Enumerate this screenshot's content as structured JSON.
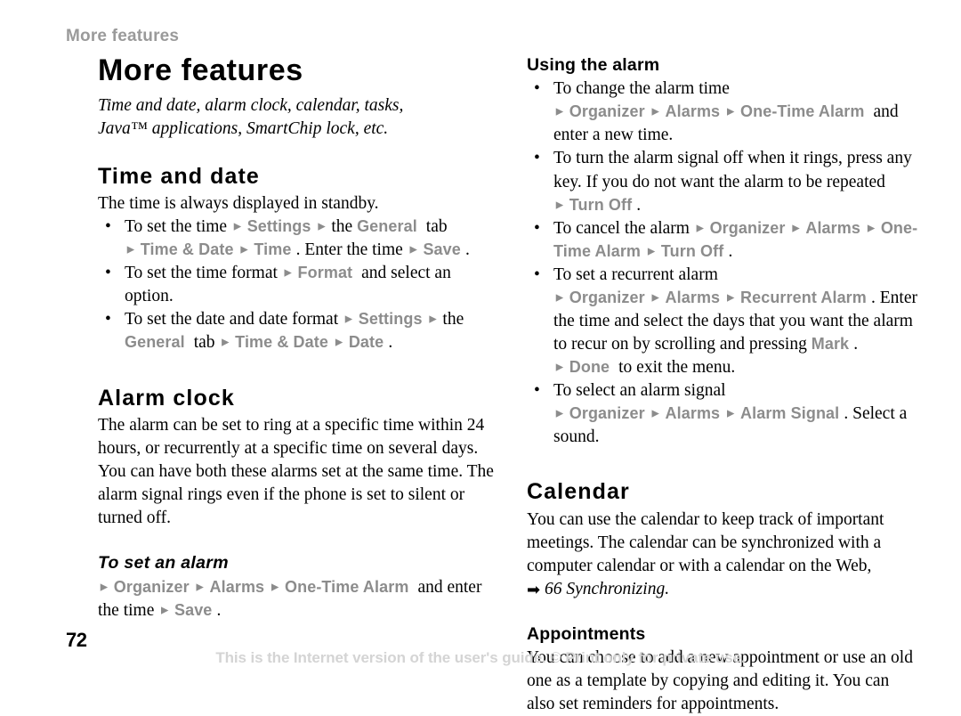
{
  "running_header": "More features",
  "title": "More features",
  "subtitle_line1": "Time and date, alarm clock, calendar, tasks,",
  "subtitle_line2": "Java™ applications, SmartChip lock, etc.",
  "icons": {
    "menu_arrow": "►",
    "xref_arrow": "➡",
    "bullet": "•"
  },
  "colors": {
    "ui_term_gray": "#8c8c8c",
    "running_header_gray": "#9a9a9a",
    "footer_gray": "#d4d4d4",
    "text_black": "#000000",
    "page_background": "#ffffff"
  },
  "left_column": {
    "section_time_and_date": {
      "heading": "Time and date",
      "intro": "The time is always displayed in standby.",
      "bullets": [
        {
          "id": "set-the-time",
          "parts": [
            {
              "t": "text",
              "v": "To set the time "
            },
            {
              "t": "arrow"
            },
            {
              "t": "ui",
              "v": "Settings"
            },
            {
              "t": "arrow"
            },
            {
              "t": "text",
              "v": "the "
            },
            {
              "t": "ui",
              "v": "General"
            },
            {
              "t": "text",
              "v": " tab "
            },
            {
              "t": "arrow"
            },
            {
              "t": "ui",
              "v": "Time & Date"
            },
            {
              "t": "arrow"
            },
            {
              "t": "ui",
              "v": "Time"
            },
            {
              "t": "text",
              "v": ". Enter the time "
            },
            {
              "t": "arrow"
            },
            {
              "t": "ui",
              "v": "Save"
            },
            {
              "t": "text",
              "v": "."
            }
          ]
        },
        {
          "id": "set-the-time-format",
          "parts": [
            {
              "t": "text",
              "v": "To set the time format "
            },
            {
              "t": "arrow"
            },
            {
              "t": "ui",
              "v": "Format"
            },
            {
              "t": "text",
              "v": " and select an option."
            }
          ]
        },
        {
          "id": "set-the-date-and-date-format",
          "parts": [
            {
              "t": "text",
              "v": "To set the date and date format "
            },
            {
              "t": "arrow"
            },
            {
              "t": "ui",
              "v": "Settings"
            },
            {
              "t": "arrow"
            },
            {
              "t": "text",
              "v": "the "
            },
            {
              "t": "ui",
              "v": "General"
            },
            {
              "t": "text",
              "v": " tab "
            },
            {
              "t": "arrow"
            },
            {
              "t": "ui",
              "v": "Time & Date"
            },
            {
              "t": "arrow"
            },
            {
              "t": "ui",
              "v": "Date"
            },
            {
              "t": "text",
              "v": "."
            }
          ]
        }
      ]
    },
    "section_alarm_clock": {
      "heading": "Alarm clock",
      "body": "The alarm can be set to ring at a specific time within 24 hours, or recurrently at a specific time on several days. You can have both these alarms set at the same time. The alarm signal rings even if the phone is set to silent or turned off.",
      "sub_to_set_an_alarm": {
        "heading": "To set an alarm",
        "parts": [
          {
            "t": "arrow"
          },
          {
            "t": "ui",
            "v": "Organizer"
          },
          {
            "t": "arrow"
          },
          {
            "t": "ui",
            "v": "Alarms"
          },
          {
            "t": "arrow"
          },
          {
            "t": "ui",
            "v": "One-Time Alarm"
          },
          {
            "t": "text",
            "v": " and enter the time "
          },
          {
            "t": "arrow"
          },
          {
            "t": "ui",
            "v": "Save"
          },
          {
            "t": "text",
            "v": "."
          }
        ]
      }
    }
  },
  "right_column": {
    "section_using_the_alarm": {
      "heading": "Using the alarm",
      "bullets": [
        {
          "id": "change-the-alarm-time",
          "parts": [
            {
              "t": "text",
              "v": "To change the alarm time "
            },
            {
              "t": "arrow"
            },
            {
              "t": "ui",
              "v": "Organizer"
            },
            {
              "t": "arrow"
            },
            {
              "t": "ui",
              "v": "Alarms"
            },
            {
              "t": "arrow"
            },
            {
              "t": "ui",
              "v": "One-Time Alarm"
            },
            {
              "t": "text",
              "v": " and enter a new time."
            }
          ]
        },
        {
          "id": "turn-alarm-signal-off",
          "parts": [
            {
              "t": "text",
              "v": "To turn the alarm signal off when it rings, press any key. If you do not want the alarm to be repeated "
            },
            {
              "t": "arrow"
            },
            {
              "t": "ui",
              "v": "Turn Off"
            },
            {
              "t": "text",
              "v": "."
            }
          ]
        },
        {
          "id": "cancel-the-alarm",
          "parts": [
            {
              "t": "text",
              "v": "To cancel the alarm "
            },
            {
              "t": "arrow"
            },
            {
              "t": "ui",
              "v": "Organizer"
            },
            {
              "t": "arrow"
            },
            {
              "t": "ui",
              "v": "Alarms"
            },
            {
              "t": "arrow"
            },
            {
              "t": "ui",
              "v": "One-Time Alarm"
            },
            {
              "t": "arrow"
            },
            {
              "t": "ui",
              "v": "Turn Off"
            },
            {
              "t": "text",
              "v": "."
            }
          ]
        },
        {
          "id": "set-a-recurrent-alarm",
          "parts": [
            {
              "t": "text",
              "v": "To set a recurrent alarm "
            },
            {
              "t": "arrow"
            },
            {
              "t": "ui",
              "v": "Organizer"
            },
            {
              "t": "arrow"
            },
            {
              "t": "ui",
              "v": "Alarms"
            },
            {
              "t": "arrow"
            },
            {
              "t": "ui",
              "v": "Recurrent Alarm"
            },
            {
              "t": "text",
              "v": ". Enter the time and select the days that you want the alarm to recur on by scrolling and pressing "
            },
            {
              "t": "ui",
              "v": "Mark"
            },
            {
              "t": "text",
              "v": ". "
            },
            {
              "t": "arrow"
            },
            {
              "t": "ui",
              "v": "Done"
            },
            {
              "t": "text",
              "v": " to exit the menu."
            }
          ]
        },
        {
          "id": "select-an-alarm-signal",
          "parts": [
            {
              "t": "text",
              "v": "To select an alarm signal "
            },
            {
              "t": "arrow"
            },
            {
              "t": "ui",
              "v": "Organizer"
            },
            {
              "t": "arrow"
            },
            {
              "t": "ui",
              "v": "Alarms"
            },
            {
              "t": "arrow"
            },
            {
              "t": "ui",
              "v": "Alarm Signal"
            },
            {
              "t": "text",
              "v": ". Select a sound."
            }
          ]
        }
      ]
    },
    "section_calendar": {
      "heading": "Calendar",
      "body": "You can use the calendar to keep track of important meetings. The calendar can be synchronized with a computer calendar or with a calendar on the Web,",
      "cross_reference": "66 Synchronizing."
    },
    "section_appointments": {
      "heading": "Appointments",
      "body": "You can choose to add a new appointment or use an old one as a template by copying and editing it. You can also set reminders for appointments."
    }
  },
  "footer": {
    "page_number": "72",
    "note": "This is the Internet version of the user's guide. © Print only for private use."
  }
}
